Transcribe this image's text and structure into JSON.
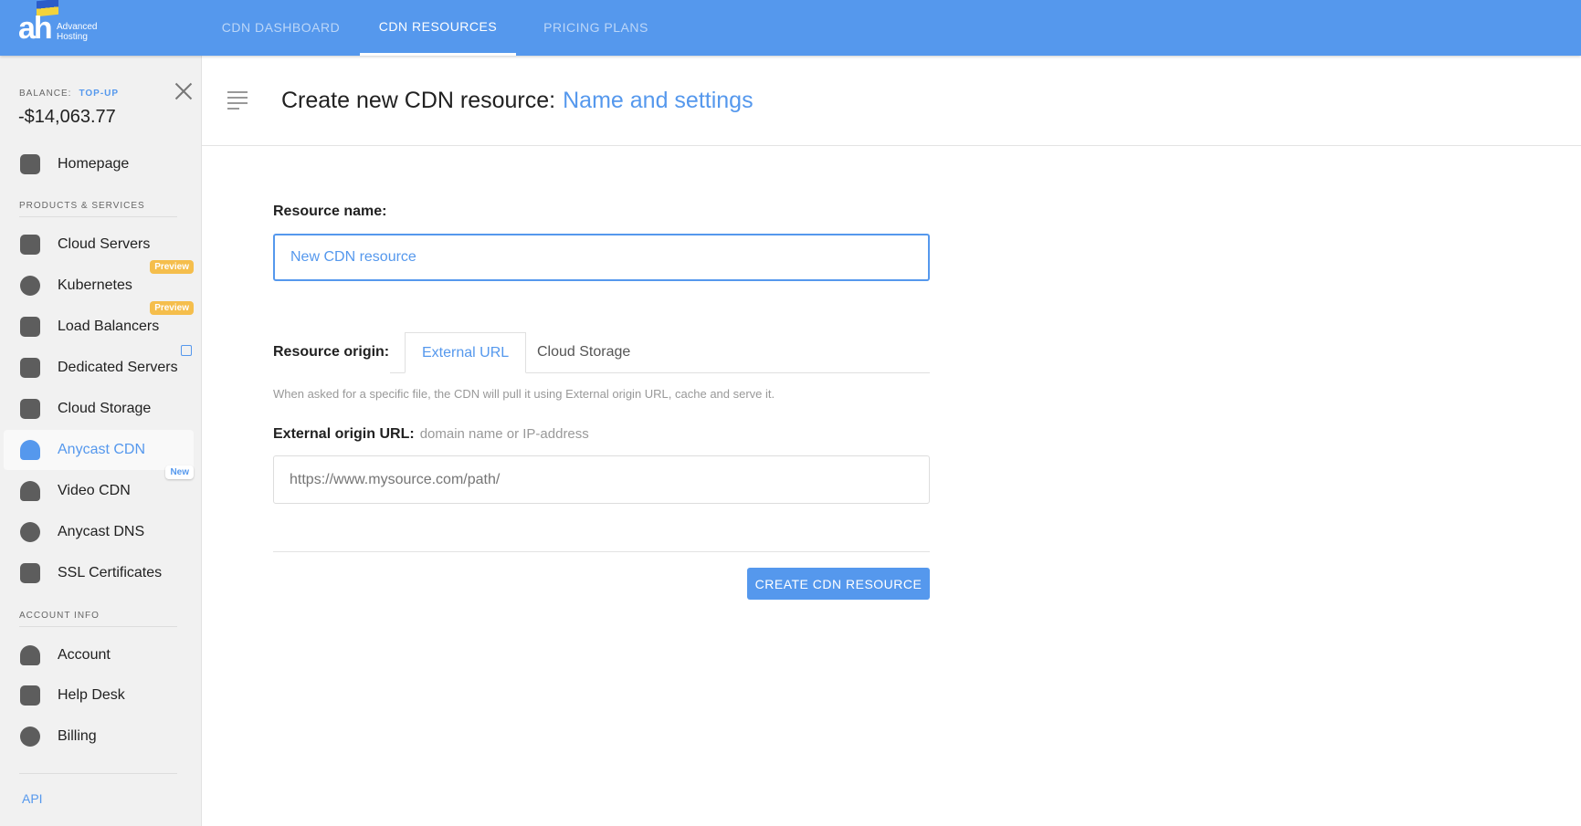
{
  "header": {
    "logo_text": "ah",
    "logo_subtitle_1": "Advanced",
    "logo_subtitle_2": "Hosting",
    "tabs": [
      {
        "label": "CDN DASHBOARD"
      },
      {
        "label": "CDN RESOURCES",
        "active": true
      },
      {
        "label": "PRICING PLANS"
      }
    ]
  },
  "sidebar": {
    "balance_label": "BALANCE:",
    "topup": "TOP-UP",
    "balance": "-$14,063.77",
    "home": {
      "label": "Homepage",
      "icon": "home-icon"
    },
    "section1": "PRODUCTS & SERVICES",
    "products": [
      {
        "label": "Cloud Servers",
        "icon": "cloud-servers-icon"
      },
      {
        "label": "Kubernetes",
        "icon": "kubernetes-icon",
        "badge": "Preview"
      },
      {
        "label": "Load Balancers",
        "icon": "load-balancer-icon",
        "badge": "Preview"
      },
      {
        "label": "Dedicated Servers",
        "icon": "server-icon"
      },
      {
        "label": "Cloud Storage",
        "icon": "storage-icon"
      },
      {
        "label": "Anycast CDN",
        "icon": "cdn-cloud-icon",
        "active": true
      },
      {
        "label": "Video CDN",
        "icon": "video-cdn-icon",
        "badge": "New"
      },
      {
        "label": "Anycast DNS",
        "icon": "dns-icon"
      },
      {
        "label": "SSL Certificates",
        "icon": "lock-icon"
      }
    ],
    "section2": "ACCOUNT INFO",
    "account": [
      {
        "label": "Account",
        "icon": "user-icon"
      },
      {
        "label": "Help Desk",
        "icon": "chat-icon"
      },
      {
        "label": "Billing",
        "icon": "dollar-icon"
      }
    ],
    "api": "API"
  },
  "main": {
    "title": "Create new CDN resource:",
    "title_step": "Name and settings",
    "resource_name_label": "Resource name:",
    "resource_name_value": "New CDN resource",
    "origin_label": "Resource origin:",
    "origin_tabs": [
      {
        "label": "External URL",
        "active": true
      },
      {
        "label": "Cloud Storage"
      }
    ],
    "help": "When asked for a specific file, the CDN will pull it using External origin URL, cache and serve it.",
    "url_label": "External origin URL:",
    "url_hint": "domain name or IP-address",
    "url_placeholder": "https://www.mysource.com/path/",
    "url_value": "",
    "create_button": "CREATE CDN RESOURCE"
  },
  "colors": {
    "accent": "#5598ed",
    "badge_preview": "#f5be4c"
  }
}
